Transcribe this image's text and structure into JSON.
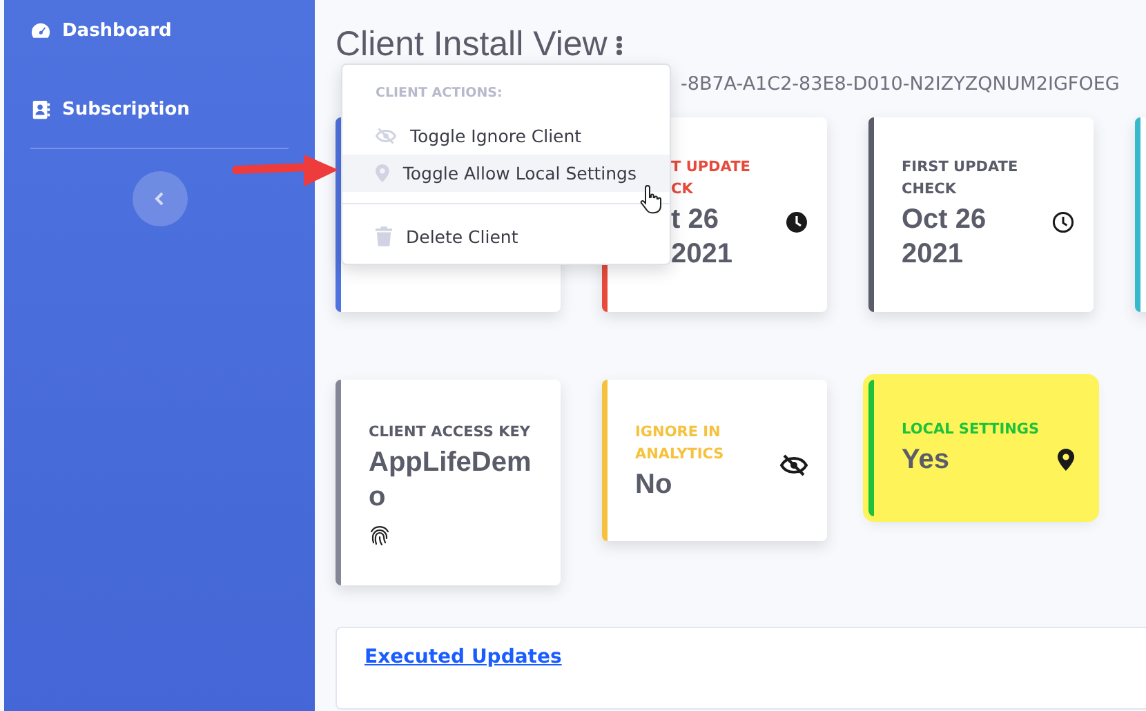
{
  "sidebar": {
    "items": [
      {
        "label": "Dashboard"
      },
      {
        "label": "Subscription"
      }
    ]
  },
  "page": {
    "title": "Client Install View",
    "subtitle_visible": "-8B7A-A1C2-83E8-D010-N2IZYZQNUM2IGFOEG"
  },
  "menu": {
    "header": "CLIENT ACTIONS:",
    "items": [
      {
        "kind": "item",
        "label": "Toggle Ignore Client",
        "hovered": false
      },
      {
        "kind": "item",
        "label": "Toggle Allow Local Settings",
        "hovered": true
      },
      {
        "kind": "divider"
      },
      {
        "kind": "item",
        "label": "Delete Client",
        "hovered": false
      }
    ]
  },
  "cards": [
    {
      "color": "#4e73df",
      "highlight": false
    },
    {
      "color": "#e74a3b",
      "label_lines": [
        "T UPDATE",
        "CK"
      ],
      "value_lines": [
        "t 26",
        "2021"
      ],
      "highlight": false
    },
    {
      "color": "#5a5c69",
      "label_lines": [
        "FIRST UPDATE",
        "CHECK"
      ],
      "value_lines": [
        "Oct 26",
        "2021"
      ],
      "highlight": false
    },
    {
      "color": "#36b9cc",
      "highlight": false
    },
    {
      "color": "#858796",
      "label_lines": [
        "CLIENT ACCESS KEY"
      ],
      "value_lines": [
        "AppLifeDem",
        "o"
      ],
      "highlight": false
    },
    {
      "color": "#f6c23e",
      "label_lines": [
        "IGNORE IN",
        "ANALYTICS"
      ],
      "value_lines": [
        "No"
      ],
      "highlight": false
    },
    {
      "color": "#1cc23a",
      "label_lines": [
        "LOCAL SETTINGS"
      ],
      "value_lines": [
        "Yes"
      ],
      "highlight": true
    }
  ],
  "panel": {
    "title": "Executed Updates"
  }
}
